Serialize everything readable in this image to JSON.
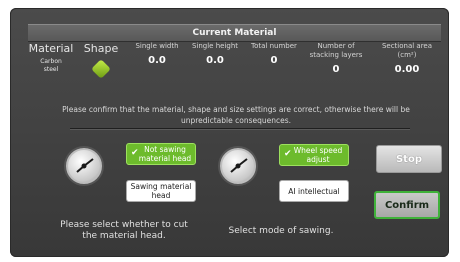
{
  "header": {
    "title": "Current Material"
  },
  "columns": {
    "material": {
      "label": "Material",
      "value": "Carbon steel"
    },
    "shape": {
      "label": "Shape"
    },
    "single_width": {
      "label": "Single width",
      "value": "0.0"
    },
    "single_height": {
      "label": "Single height",
      "value": "0.0"
    },
    "total_number": {
      "label": "Total number",
      "value": "0"
    },
    "stacking_layers": {
      "label": "Number of stacking layers",
      "value": "0"
    },
    "sectional_area": {
      "label": "Sectional area (cm²)",
      "value": "0.00"
    }
  },
  "warning": "Please confirm that the material, shape and size settings are correct, otherwise there will be unpredictable consequences.",
  "head_select": {
    "option_not_sawing": "Not sawing material head",
    "option_sawing": "Sawing material head",
    "hint": "Please select whether to cut the material head."
  },
  "mode_select": {
    "option_wheel_speed": "Wheel speed adjust",
    "option_ai": "AI intellectual",
    "hint": "Select mode of sawing."
  },
  "buttons": {
    "stop": "Stop",
    "confirm": "Confirm"
  },
  "colors": {
    "accent_green": "#6dbb2c",
    "confirm_border": "#3fb23a"
  }
}
